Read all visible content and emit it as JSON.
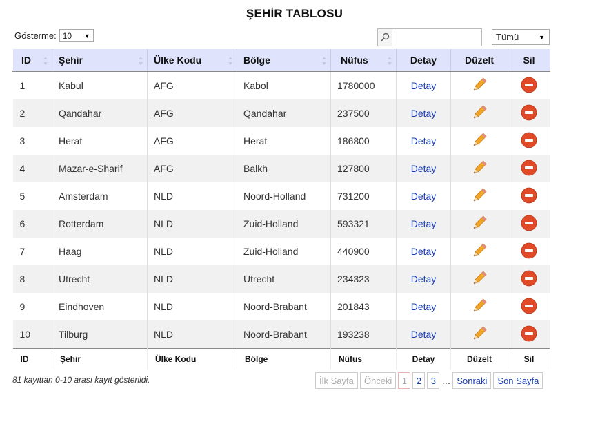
{
  "title": "ŞEHİR TABLOSU",
  "controls": {
    "show_label": "Gösterme:",
    "show_value": "10",
    "search_value": "",
    "filter_value": "Tümü"
  },
  "columns": [
    "ID",
    "Şehir",
    "Ülke Kodu",
    "Bölge",
    "Nüfus",
    "Detay",
    "Düzelt",
    "Sil"
  ],
  "rows": [
    {
      "id": "1",
      "city": "Kabul",
      "country": "AFG",
      "region": "Kabol",
      "population": "1780000",
      "detail": "Detay"
    },
    {
      "id": "2",
      "city": "Qandahar",
      "country": "AFG",
      "region": "Qandahar",
      "population": "237500",
      "detail": "Detay"
    },
    {
      "id": "3",
      "city": "Herat",
      "country": "AFG",
      "region": "Herat",
      "population": "186800",
      "detail": "Detay"
    },
    {
      "id": "4",
      "city": "Mazar-e-Sharif",
      "country": "AFG",
      "region": "Balkh",
      "population": "127800",
      "detail": "Detay"
    },
    {
      "id": "5",
      "city": "Amsterdam",
      "country": "NLD",
      "region": "Noord-Holland",
      "population": "731200",
      "detail": "Detay"
    },
    {
      "id": "6",
      "city": "Rotterdam",
      "country": "NLD",
      "region": "Zuid-Holland",
      "population": "593321",
      "detail": "Detay"
    },
    {
      "id": "7",
      "city": "Haag",
      "country": "NLD",
      "region": "Zuid-Holland",
      "population": "440900",
      "detail": "Detay"
    },
    {
      "id": "8",
      "city": "Utrecht",
      "country": "NLD",
      "region": "Utrecht",
      "population": "234323",
      "detail": "Detay"
    },
    {
      "id": "9",
      "city": "Eindhoven",
      "country": "NLD",
      "region": "Noord-Brabant",
      "population": "201843",
      "detail": "Detay"
    },
    {
      "id": "10",
      "city": "Tilburg",
      "country": "NLD",
      "region": "Noord-Brabant",
      "population": "193238",
      "detail": "Detay"
    }
  ],
  "info": "81 kayıttan 0-10 arası kayıt gösterildi.",
  "pagination": {
    "first": "İlk Sayfa",
    "prev": "Önceki",
    "pages": [
      "1",
      "2",
      "3"
    ],
    "ellipsis": "…",
    "next": "Sonraki",
    "last": "Son Sayfa"
  },
  "icons": {
    "search": "search-icon",
    "edit": "pencil-icon",
    "delete": "delete-icon",
    "sort": "sort-arrows-icon"
  },
  "colors": {
    "header_bg": "#dfe3fb",
    "link": "#1a3fb0",
    "delete_red": "#e04a26",
    "pencil": "#f0a020"
  }
}
